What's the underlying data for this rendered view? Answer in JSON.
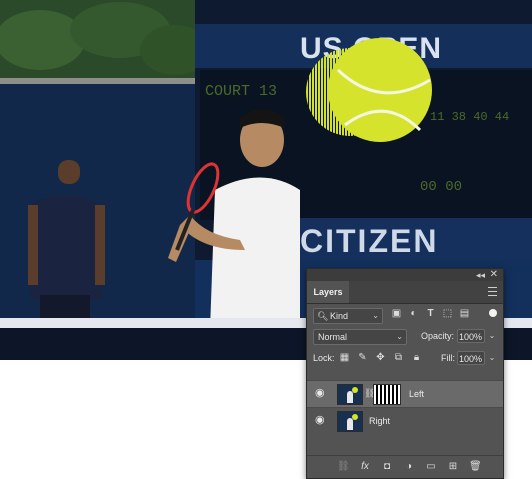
{
  "photo": {
    "scoreboard": {
      "banner_text": "US OPEN",
      "court_label": "COURT 13",
      "score_left": "11 38 40 44",
      "score_mid": "00 00",
      "sponsor_text": "CITIZEN"
    }
  },
  "panel": {
    "tab_label": "Layers",
    "filter": {
      "kind_label": "Kind",
      "icons": [
        "image-filter-icon",
        "adjustment-filter-icon",
        "type-filter-icon",
        "shape-filter-icon",
        "smart-object-filter-icon"
      ]
    },
    "blend_mode": "Normal",
    "opacity_label": "Opacity:",
    "opacity_value": "100%",
    "lock_label": "Lock:",
    "lock_icons": [
      "lock-transparent-icon",
      "lock-image-icon",
      "lock-position-icon",
      "lock-artboard-icon",
      "lock-all-icon"
    ],
    "fill_label": "Fill:",
    "fill_value": "100%",
    "layers": [
      {
        "name": "Left",
        "selected": true,
        "has_mask": true
      },
      {
        "name": "Right",
        "selected": false,
        "has_mask": false
      }
    ],
    "bottom_icons": [
      "link-layers-icon",
      "fx-icon",
      "add-mask-icon",
      "adjustment-layer-icon",
      "new-group-icon",
      "new-layer-icon",
      "delete-layer-icon"
    ]
  },
  "colors": {
    "panel_bg": "#535353",
    "selected_layer": "#6a6a6a",
    "ball": "#d8e22c"
  }
}
